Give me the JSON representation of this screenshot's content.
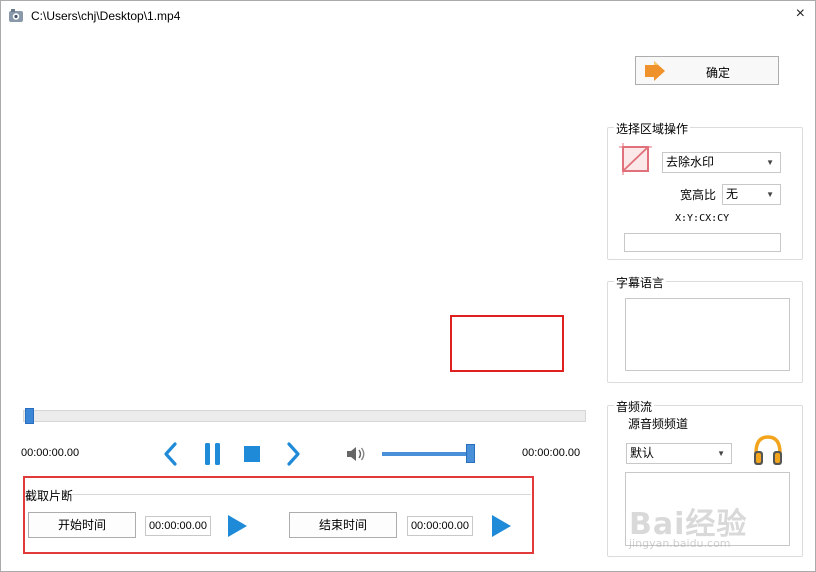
{
  "window": {
    "title": "C:\\Users\\chj\\Desktop\\1.mp4",
    "close_glyph": "×"
  },
  "player": {
    "current_time": "00:00:00.00",
    "end_time": "00:00:00.00",
    "seek_position": 0,
    "volume": 0.95
  },
  "clip": {
    "legend": "截取片断",
    "start_button": "开始时间",
    "start_time": "00:00:00.00",
    "end_button": "结束时间",
    "end_time": "00:00:00.00"
  },
  "right": {
    "ok_label": "确定",
    "region": {
      "legend": "选择区域操作",
      "operation": "去除水印",
      "aspect_label": "宽高比",
      "aspect_value": "无",
      "coord_label": "X:Y:CX:CY",
      "coord_value": ""
    },
    "subtitle": {
      "legend": "字幕语言"
    },
    "audio": {
      "legend": "音频流",
      "channel_label": "源音频频道",
      "channel_value": "默认"
    }
  },
  "watermark": {
    "brand": "Bai经验",
    "url": "jingyan.baidu.com"
  },
  "colors": {
    "accent": "#1f8ad8",
    "highlight_red": "#e02020"
  }
}
